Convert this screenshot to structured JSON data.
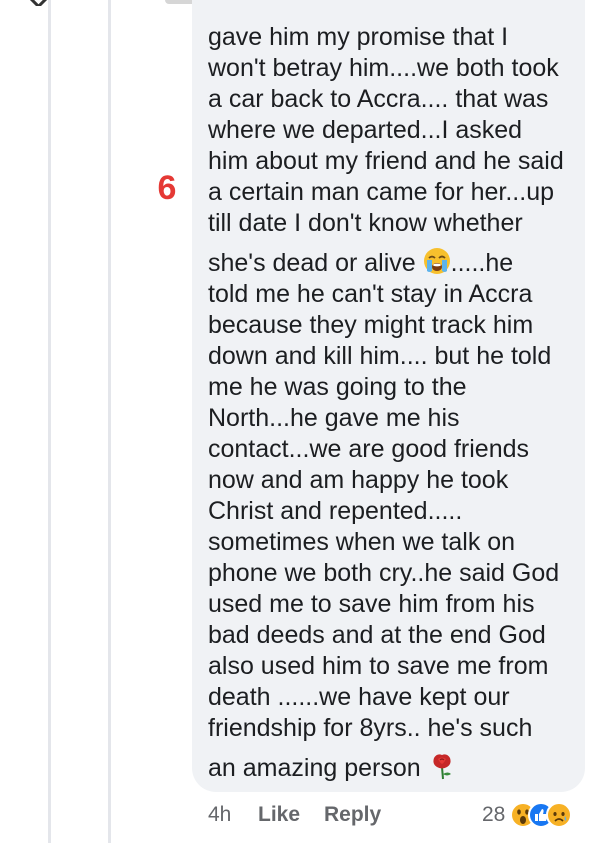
{
  "annotation": {
    "number": "6"
  },
  "comment": {
    "lines": [
      "gave him my promise that I",
      "won't betray him....we both took",
      "a car back to Accra.... that was",
      "where we departed...I asked",
      "him about my friend and he said",
      "a certain man came for her...up",
      "till date I don't know whether",
      "she's dead or alive",
      ".....he",
      "told me he can't stay in Accra",
      "because they might track him",
      "down and kill him.... but he told",
      "me he was going to the",
      "North...he gave me his",
      "contact...we are good friends",
      "now and am happy he took",
      "Christ and repented.....",
      "sometimes when we talk on",
      "phone we both cry..he said God",
      "used me to save him from his",
      "bad deeds and at the end God",
      "also used him to save me from",
      "death ......we have kept our",
      "friendship for 8yrs.. he's such",
      "an amazing person"
    ],
    "emoji_crying": "loudly-crying-face-icon",
    "emoji_rose": "rose-icon"
  },
  "actions": {
    "time": "4h",
    "like_label": "Like",
    "reply_label": "Reply"
  },
  "reactions": {
    "count": "28",
    "icons": [
      "wow-reaction-icon",
      "like-reaction-icon",
      "sad-reaction-icon"
    ]
  },
  "colors": {
    "bubble": "#f0f2f5",
    "text": "#1c1e21",
    "meta": "#65676b",
    "annotation": "#e53935",
    "like_blue": "#1877f2",
    "reaction_yellow": "#f7b125"
  }
}
